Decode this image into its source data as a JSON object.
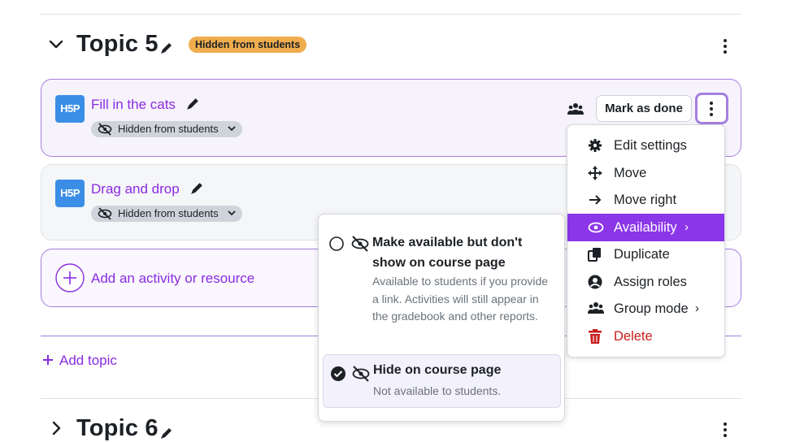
{
  "topic5": {
    "title": "Topic 5",
    "badge": "Hidden from students"
  },
  "activities": [
    {
      "icon_text": "H5P",
      "name": "Fill in the cats",
      "visibility": "Hidden from students",
      "mark_done": "Mark as done"
    },
    {
      "icon_text": "H5P",
      "name": "Drag and drop",
      "visibility": "Hidden from students"
    }
  ],
  "add_activity": "Add an activity or resource",
  "add_topic": "Add topic",
  "topic6": {
    "title": "Topic 6"
  },
  "action_menu": {
    "items": [
      {
        "label": "Edit settings",
        "icon": "gear-icon"
      },
      {
        "label": "Move",
        "icon": "move-arrows-icon"
      },
      {
        "label": "Move right",
        "icon": "arrow-right-icon"
      },
      {
        "label": "Availability",
        "icon": "eye-icon",
        "active": true
      },
      {
        "label": "Duplicate",
        "icon": "duplicate-icon"
      },
      {
        "label": "Assign roles",
        "icon": "user-circle-icon"
      },
      {
        "label": "Group mode",
        "icon": "users-icon"
      },
      {
        "label": "Delete",
        "icon": "trash-icon",
        "danger": true
      }
    ]
  },
  "availability_popup": {
    "option1_title": "Make available but don't show on course page",
    "option1_desc": "Available to students if you provide a link. Activities will still appear in the gradebook and other reports.",
    "option2_title": "Hide on course page",
    "option2_desc": "Not available to students.",
    "selected": "option2"
  },
  "colors": {
    "accent": "#8b36e8",
    "badge_warning": "#f0ad4e",
    "danger": "#c81e1e",
    "h5p_blue": "#3a8ee6"
  }
}
